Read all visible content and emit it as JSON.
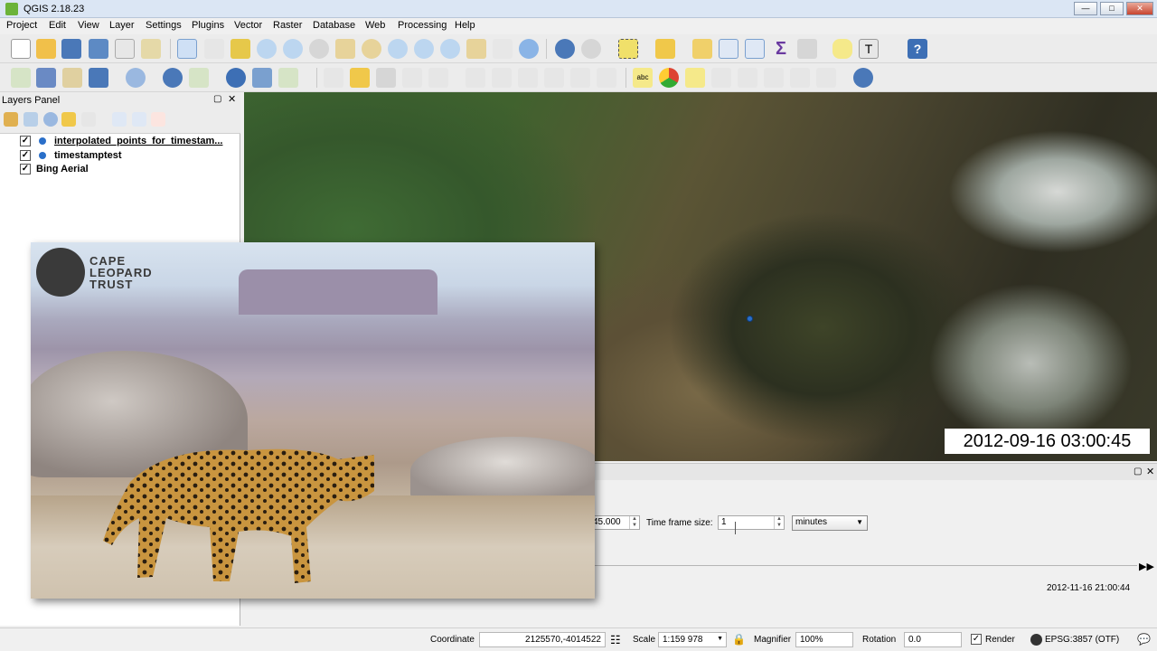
{
  "window": {
    "title": "QGIS 2.18.23"
  },
  "menu": [
    "Project",
    "Edit",
    "View",
    "Layer",
    "Settings",
    "Plugins",
    "Vector",
    "Raster",
    "Database",
    "Web",
    "Processing",
    "Help"
  ],
  "layers_panel": {
    "title": "Layers Panel",
    "layers": [
      {
        "name": "interpolated_points_for_timestam...",
        "checked": true,
        "symbol": "point"
      },
      {
        "name": "timestamptest",
        "checked": true,
        "symbol": "point"
      },
      {
        "name": "Bing Aerial",
        "checked": true,
        "symbol": "none"
      }
    ]
  },
  "map": {
    "timestamp": "2012-09-16 03:00:45"
  },
  "time_manager": {
    "offset_value": "45.000",
    "time_frame_label": "Time frame size:",
    "time_frame_value": "1",
    "time_unit": "minutes",
    "end_time": "2012-11-16 21:00:44"
  },
  "photo_overlay": {
    "logo_text": [
      "CAPE",
      "LEOPARD",
      "TRUST"
    ]
  },
  "statusbar": {
    "coordinate_label": "Coordinate",
    "coordinate_value": "2125570,-4014522",
    "scale_label": "Scale",
    "scale_value": "1:159 978",
    "magnifier_label": "Magnifier",
    "magnifier_value": "100%",
    "rotation_label": "Rotation",
    "rotation_value": "0.0",
    "render_label": "Render",
    "crs_label": "EPSG:3857 (OTF)"
  },
  "colors": {
    "point": "#2a6fc9",
    "titlebar": "#dbe6f4"
  }
}
